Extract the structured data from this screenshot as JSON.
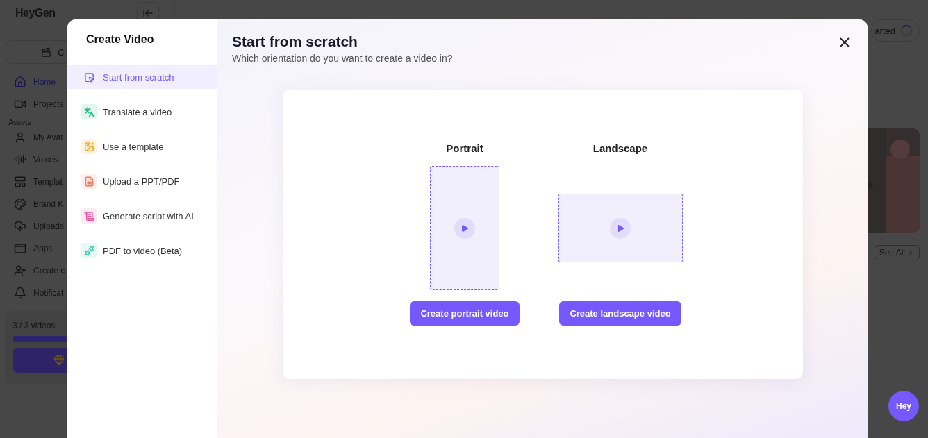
{
  "app": {
    "logo": "HeyGen",
    "create_button": "C",
    "nav": [
      {
        "kind": "home",
        "label": "Home",
        "selected": true
      },
      {
        "kind": "video",
        "label": "Projects",
        "selected": false
      }
    ],
    "assets_label": "Assets",
    "asset_nav": [
      {
        "kind": "avatar",
        "label": "My Avat",
        "selected": false
      },
      {
        "kind": "voice",
        "label": "Voices",
        "selected": false
      },
      {
        "kind": "template",
        "label": "Templat",
        "selected": false
      },
      {
        "kind": "brand",
        "label": "Brand K",
        "selected": false
      },
      {
        "kind": "upload",
        "label": "Uploads",
        "selected": false
      },
      {
        "kind": "apps",
        "label": "Apps",
        "selected": false
      },
      {
        "kind": "adduser",
        "label": "Create c",
        "selected": false
      },
      {
        "kind": "bell",
        "label": "Notificat",
        "selected": false
      }
    ],
    "usage": {
      "text": "3 / 3 videos",
      "level": 1
    },
    "status_pill": "arted",
    "see_all": "See All"
  },
  "modal": {
    "title": "Create Video",
    "menu": [
      {
        "kind": "cursor",
        "label": "Start from scratch",
        "selected": true,
        "color": "#7559ff"
      },
      {
        "kind": "translate",
        "label": "Translate a video",
        "selected": false,
        "color": "#14b87a"
      },
      {
        "kind": "template",
        "label": "Use a template",
        "selected": false,
        "color": "#f5a623"
      },
      {
        "kind": "document",
        "label": "Upload a PPT/PDF",
        "selected": false,
        "color": "#f2795a"
      },
      {
        "kind": "script",
        "label": "Generate script with AI",
        "selected": false,
        "color": "#f0509a"
      },
      {
        "kind": "pdf",
        "label": "PDF to video (Beta)",
        "selected": false,
        "color": "#2ecfa8"
      }
    ],
    "heading": "Start from scratch",
    "subtitle": "Which orientation do you want to create a video in?",
    "options": [
      {
        "kind": "portrait",
        "title": "Portrait",
        "button": "Create portrait video"
      },
      {
        "kind": "landscape",
        "title": "Landscape",
        "button": "Create landscape video"
      }
    ]
  },
  "chat_button": "Hey"
}
